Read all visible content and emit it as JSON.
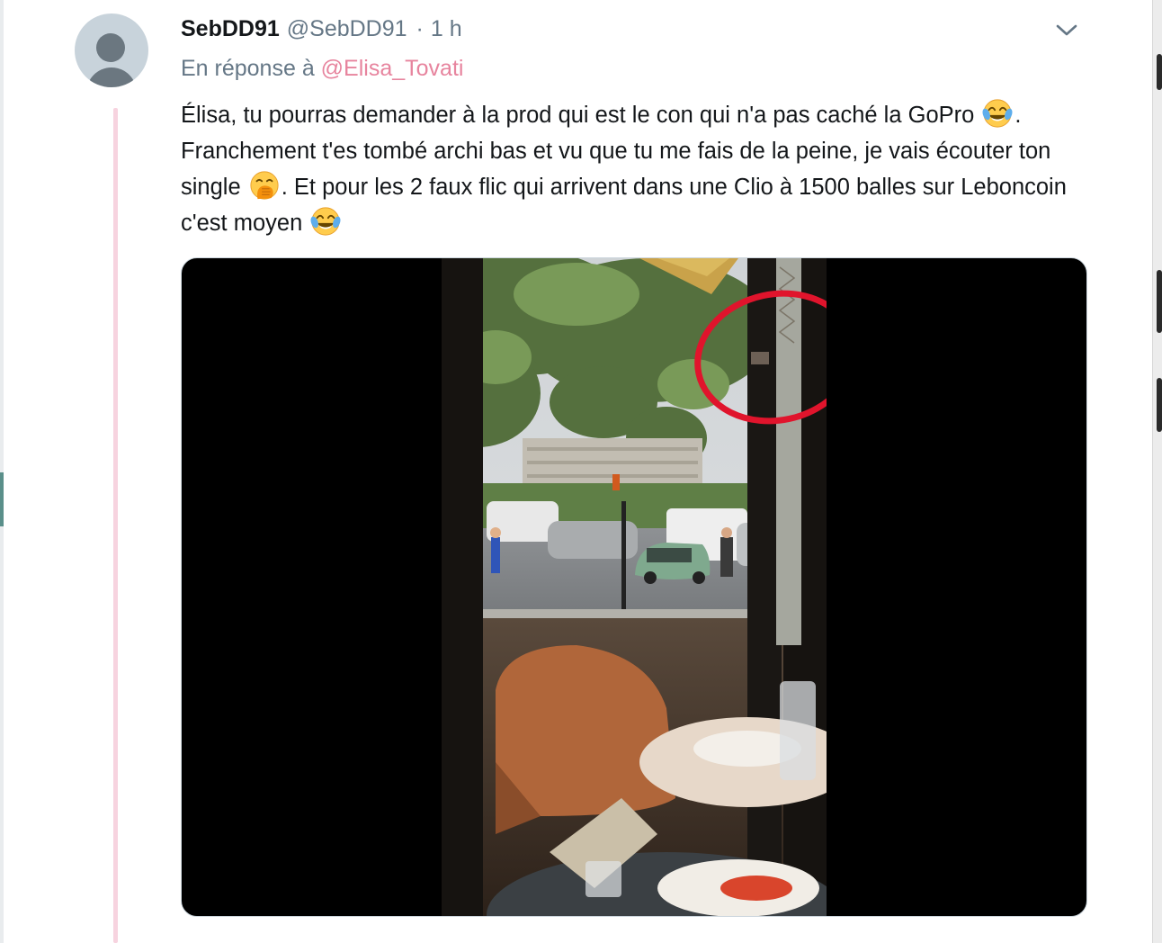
{
  "tweet": {
    "display_name": "SebDD91",
    "handle": "@SebDD91",
    "separator": "·",
    "time": "1 h",
    "reply_prefix": "En réponse à",
    "reply_to": "@Elisa_Tovati",
    "text": {
      "part1": "Élisa, tu pourras demander à la prod qui est le con qui n'a pas caché la GoPro ",
      "part2": ". Franchement t'es tombé archi bas et vu que tu me fais de la peine,  je vais écouter ton single ",
      "part3": ". Et pour les 2 faux flic qui arrivent dans une Clio à 1500 balles sur Leboncoin c'est moyen "
    },
    "emojis": [
      "face-with-tears-of-joy-icon",
      "face-with-hand-over-mouth-icon",
      "face-with-tears-of-joy-icon"
    ],
    "media": {
      "type": "video",
      "scene": "café window view onto a Paris street with cars, trees and a chair; red circle drawn around a hidden camera"
    }
  },
  "colors": {
    "text_primary": "#14171a",
    "text_secondary": "#657786",
    "mention": "#e7849e",
    "thread_line": "#f7d3df",
    "media_border": "#ccd6dd",
    "annotation_circle": "#e0142c"
  }
}
